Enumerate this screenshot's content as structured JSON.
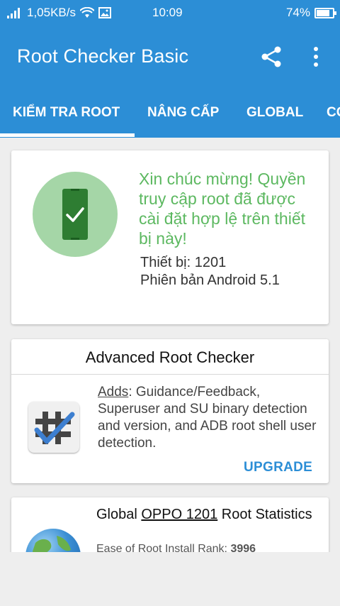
{
  "status_bar": {
    "network_speed": "1,05KB/s",
    "time": "10:09",
    "battery_percent": "74%",
    "battery_level": 0.74,
    "icons": [
      "signal-icon",
      "wifi-icon",
      "image-icon",
      "battery-icon"
    ]
  },
  "app_bar": {
    "title": "Root Checker Basic",
    "actions": [
      "share-icon",
      "more-vert-icon"
    ]
  },
  "tabs": [
    {
      "label": "KIỂM TRA ROOT",
      "selected": true
    },
    {
      "label": "NÂNG CẤP",
      "selected": false
    },
    {
      "label": "GLOBAL",
      "selected": false
    },
    {
      "label": "CO",
      "selected": false
    }
  ],
  "root_status": {
    "message": "Xin chúc mừng! Quyền truy cập root đã được cài đặt hợp lệ trên thiết bị này!",
    "device": "Thiết bị: 1201",
    "android_version": "Phiên bản Android 5.1",
    "icon": "phone-check-icon"
  },
  "advanced": {
    "title": "Advanced Root Checker",
    "adds_label": "Adds",
    "description": ": Guidance/Feedback, Superuser and SU binary detection and version, and ADB root shell user detection.",
    "upgrade_label": "UPGRADE",
    "icon": "root-checker-pro-icon"
  },
  "global_stats": {
    "title_prefix": "Global ",
    "title_link": "OPPO 1201",
    "title_suffix": " Root Statistics",
    "rank_label": "Ease of Root Install Rank: ",
    "rank_value": "3996",
    "icon": "globe-icon"
  },
  "colors": {
    "primary": "#2c8ed6",
    "success_green": "#5cb860",
    "circle_green": "#a5d6a7"
  }
}
